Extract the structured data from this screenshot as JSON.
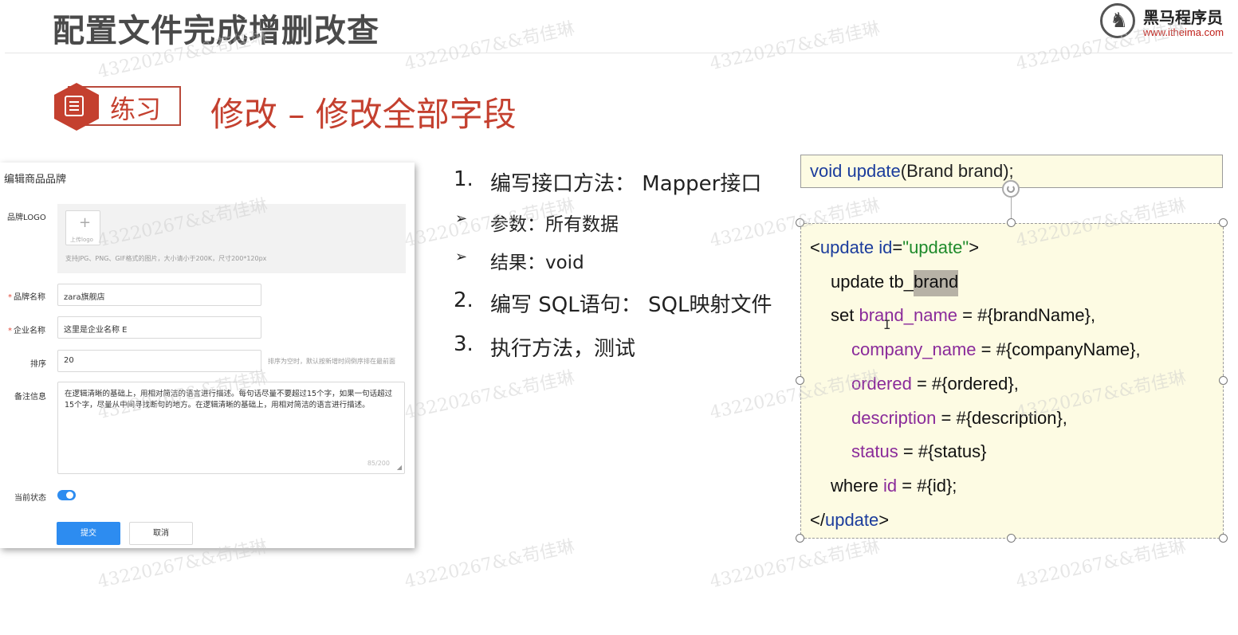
{
  "slide": {
    "title": "配置文件完成增删改查",
    "brand_name": "黑马程序员",
    "brand_url": "www.itheima.com",
    "exercise_label": "练习",
    "section_heading": "修改 – 修改全部字段"
  },
  "form": {
    "title": "编辑商品品牌",
    "logo_label": "品牌LOGO",
    "upload_label": "上传logo",
    "upload_hint": "支持JPG、PNG、GIF格式的图片，大小请小于200K，尺寸200*120px",
    "brand_name_label": "品牌名称",
    "brand_name_value": "zara旗舰店",
    "company_name_label": "企业名称",
    "company_name_value": "这里是企业名称 E",
    "sort_label": "排序",
    "sort_value": "20",
    "sort_hint": "排序为空时，默认按新增时间倒序排在最前面",
    "remark_label": "备注信息",
    "remark_value": "在逻辑清晰的基础上，用相对简洁的语言进行描述。每句话尽量不要超过15个字，如果一句话超过15个字，尽量从中间寻找断句的地方。在逻辑清晰的基础上，用相对简洁的语言进行描述。",
    "remark_count": "85/200",
    "status_label": "当前状态",
    "status_on": true,
    "submit_label": "提交",
    "cancel_label": "取消",
    "accent_color": "#2d8cf0"
  },
  "steps": {
    "step1_num": "1.",
    "step1_text": "编写接口方法： Mapper接口",
    "sub1_bullet": "➢",
    "sub1_text": "参数：所有数据",
    "sub2_bullet": "➢",
    "sub2_text": "结果：void",
    "step2_num": "2.",
    "step2_text": "编写 SQL语句： SQL映射文件",
    "step3_num": "3.",
    "step3_text": "执行方法，测试"
  },
  "code": {
    "signature": {
      "kw": "void",
      "name": "update",
      "rest": "(Brand brand);"
    },
    "open_tag": {
      "lt": "<",
      "tag": "update",
      "attr": "id",
      "eq": "=",
      "value": "\"update\"",
      "gt": ">"
    },
    "update_line": {
      "prefix": "update tb_",
      "selected": "brand"
    },
    "set_line": {
      "kw": "set",
      "col": "brand_name",
      "rest": "= #{brandName},"
    },
    "company_line": {
      "col": "company_name",
      "rest": "= #{companyName},"
    },
    "ordered_line": {
      "col": "ordered",
      "rest": "= #{ordered},"
    },
    "description_line": {
      "col": "description",
      "rest": "= #{description},"
    },
    "status_line": {
      "col": "status",
      "rest": "= #{status}"
    },
    "where_line": {
      "kw": "where",
      "col": "id",
      "rest": "= #{id};"
    },
    "close_tag": {
      "lt": "</",
      "tag": "update",
      "gt": ">"
    }
  },
  "watermark": "43220267&&苟佳琳",
  "colors": {
    "accent_red": "#c4402f",
    "code_bg": "#fdfbe3",
    "code_tag": "#1b3c9c",
    "code_string": "#1e8a2a",
    "code_column": "#8a2b9a"
  }
}
